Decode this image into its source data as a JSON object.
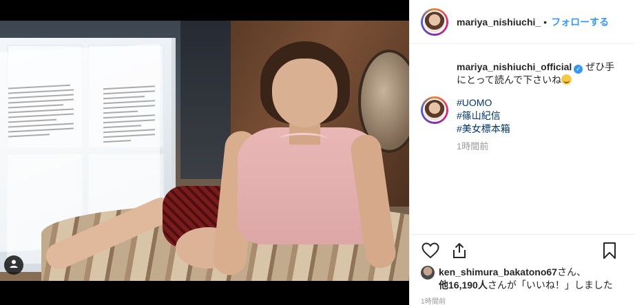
{
  "post": {
    "author": "mariya_nishiuchi_",
    "separator": "•",
    "follow_label": "フォローする"
  },
  "caption": {
    "username": "mariya_nishiuchi_official",
    "verified_mark": "✓",
    "text_line1": "ぜひ手",
    "text_line2": "にとって読んで下さいね"
  },
  "hashtags": [
    "#UOMO",
    "#篠山紀信",
    "#美女標本箱"
  ],
  "relative_time": "1時間前",
  "likes": {
    "liker": "ken_shimura_bakatono67",
    "san_suffix": "さん、",
    "others_prefix": "他",
    "others_count": "16,190人",
    "others_suffix": "さんが「いいね！」しました"
  },
  "timestamp": "1時間前",
  "icons": {
    "heart": "heart-icon",
    "share": "share-icon",
    "bookmark": "bookmark-icon",
    "user_tag": "user-tag-icon"
  },
  "colors": {
    "link_blue": "#3897f0",
    "hashtag_navy": "#003569",
    "muted_gray": "#999999"
  }
}
